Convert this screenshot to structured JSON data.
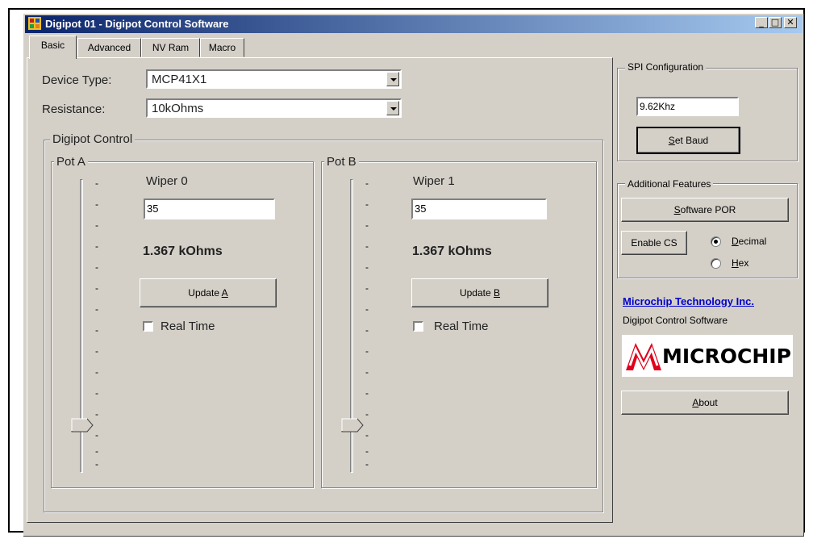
{
  "window": {
    "title": "Digipot 01 - Digipot Control Software"
  },
  "tabs": [
    {
      "label": "Basic"
    },
    {
      "label": "Advanced"
    },
    {
      "label": "NV Ram"
    },
    {
      "label": "Macro"
    }
  ],
  "form": {
    "device_type_label": "Device Type:",
    "device_type_value": "MCP41X1",
    "resistance_label": "Resistance:",
    "resistance_value": "10kOhms"
  },
  "digipot_control": {
    "title": "Digipot Control",
    "pot_a": {
      "title": "Pot A",
      "wiper_label": "Wiper 0",
      "wiper_value": "35",
      "resistance": "1.367 kOhms",
      "update_label_prefix": "Update ",
      "update_label_key": "A",
      "realtime_label": "Real Time",
      "realtime_checked": false,
      "slider_position_fraction": 0.14
    },
    "pot_b": {
      "title": "Pot B",
      "wiper_label": "Wiper 1",
      "wiper_value": "35",
      "resistance": "1.367 kOhms",
      "update_label_prefix": "Update ",
      "update_label_key": "B",
      "realtime_label": "Real Time",
      "realtime_checked": false,
      "slider_position_fraction": 0.14
    }
  },
  "spi": {
    "title": "SPI Configuration",
    "baud_value": "9.62Khz",
    "set_baud_key": "S",
    "set_baud_rest": "et Baud"
  },
  "features": {
    "title": "Additional Features",
    "por_key": "S",
    "por_rest": "oftware POR",
    "enable_cs_label": "Enable CS",
    "decimal_key": "D",
    "decimal_rest": "ecimal",
    "hex_key": "H",
    "hex_rest": "ex",
    "selected_format": "Decimal"
  },
  "branding": {
    "company_link": "Microchip Technology Inc.",
    "software_name": "Digipot Control Software",
    "logo_text": "MICROCHIP",
    "about_key": "A",
    "about_rest": "bout"
  },
  "caption_buttons": {
    "minimize": "_",
    "maximize": "□",
    "close": "✕"
  },
  "colors": {
    "titlebar_start": "#0a246a",
    "titlebar_end": "#a6caf0",
    "link": "#0000cc",
    "logo_red": "#e0001b",
    "face": "#d4d0c8"
  }
}
